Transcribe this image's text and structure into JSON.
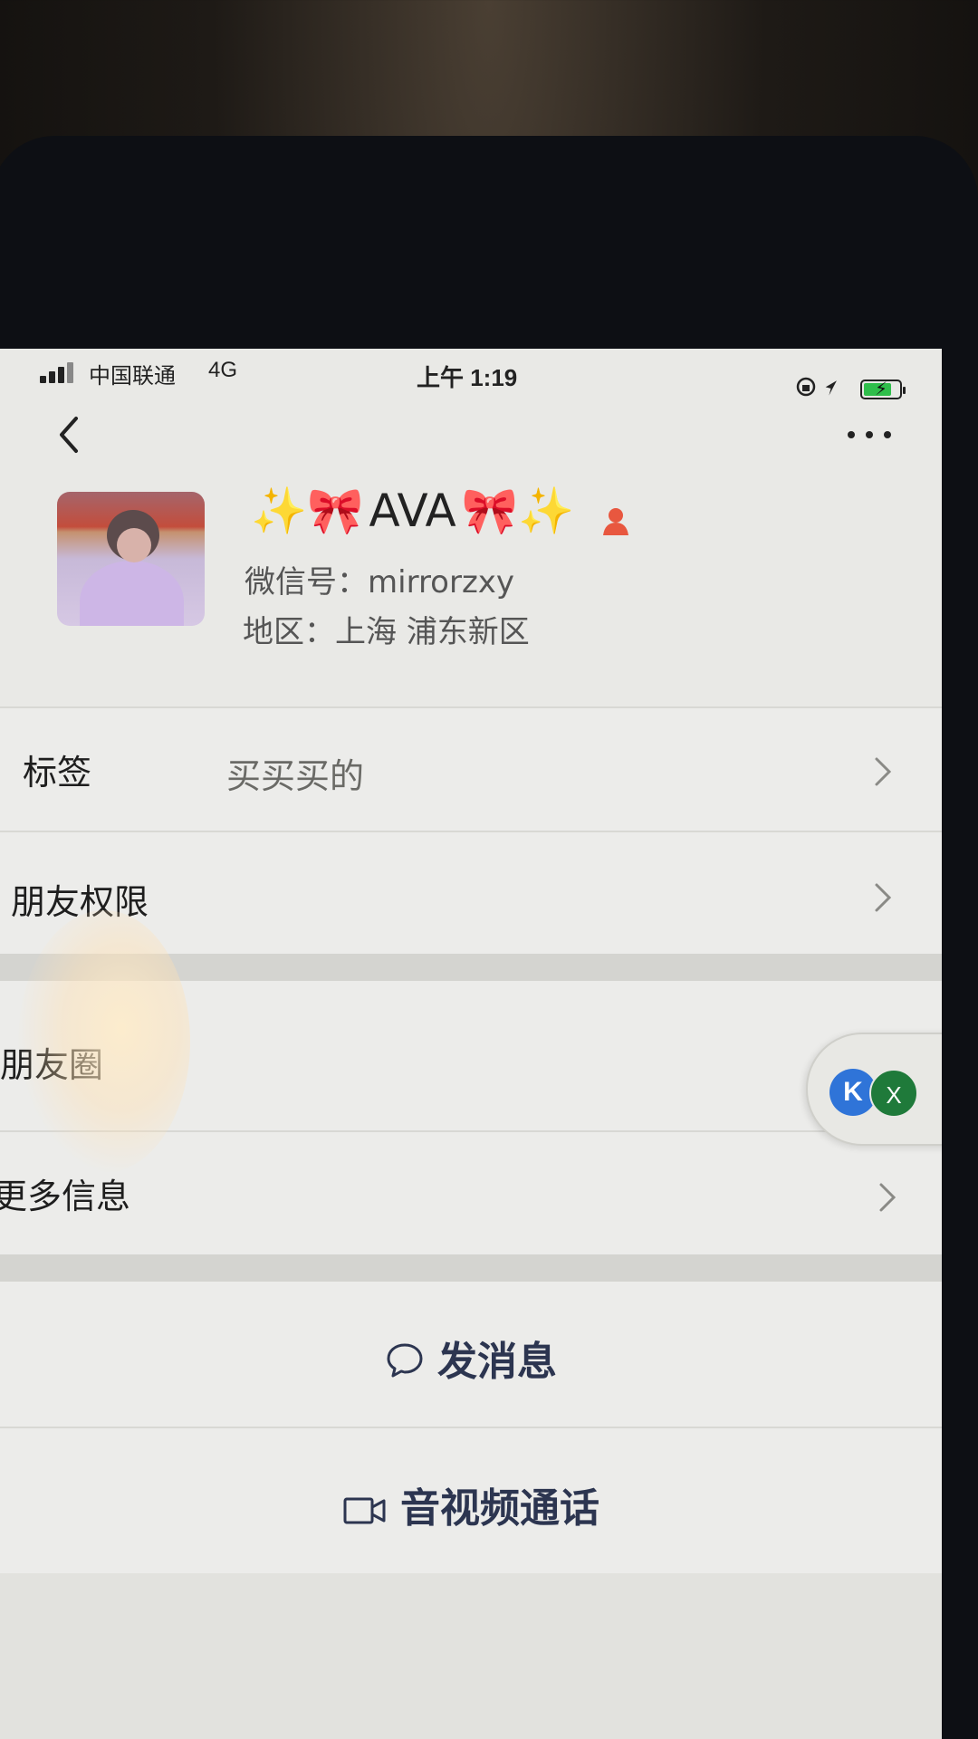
{
  "status_bar": {
    "carrier": "中国联通",
    "network": "4G",
    "time": "上午 1:19",
    "battery_color": "#2fbe4b"
  },
  "nav": {
    "back_icon": "chevron-left-icon",
    "more_icon": "ellipsis-icon"
  },
  "profile": {
    "nickname_prefix": "✨🎀",
    "nickname": "AVA",
    "nickname_suffix": "🎀✨",
    "gender_icon": "female-icon",
    "wechat_id": "微信号：mirrorzxy",
    "region": "地区：上海  浦东新区"
  },
  "rows": {
    "tags_label": "标签",
    "tags_value": "买买买的",
    "permissions_label": "朋友权限",
    "moments_label": "朋友圈",
    "more_info_label": "更多信息"
  },
  "actions": {
    "message_label": "发消息",
    "call_label": "音视频通话"
  },
  "floating_bubble": {
    "badge_1": "K",
    "badge_2": "X"
  },
  "colors": {
    "accent_text": "#2c3550",
    "background": "#ececea"
  }
}
